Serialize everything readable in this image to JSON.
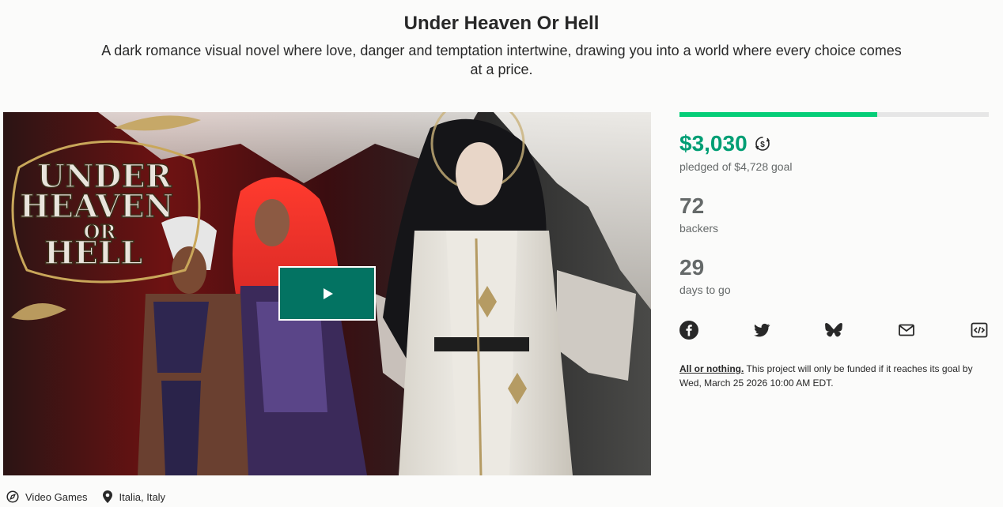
{
  "project": {
    "title": "Under Heaven Or Hell",
    "blurb": "A dark romance visual novel where love, danger and temptation intertwine, drawing you into a world where every choice comes at a price."
  },
  "media": {
    "logo_lines": [
      "UNDER",
      "HEAVEN",
      "OR",
      "HELL"
    ],
    "play_icon": "play-icon"
  },
  "funding": {
    "progress_fraction": 0.64,
    "pledged": "$3,030",
    "pledged_label": "pledged of $4,728 goal",
    "backers": "72",
    "backers_label": "backers",
    "days": "29",
    "days_label": "days to go"
  },
  "share": {
    "icons": [
      "facebook-icon",
      "twitter-icon",
      "bluesky-icon",
      "email-icon",
      "embed-icon"
    ]
  },
  "all_or_nothing": {
    "link": "All or nothing.",
    "text": " This project will only be funded if it reaches its goal by Wed, March 25 2026 10:00 AM EDT."
  },
  "meta": {
    "category": "Video Games",
    "location": "Italia, Italy"
  },
  "colors": {
    "accent_green": "#009e74",
    "progress_green": "#05ce78",
    "play_button": "#037362"
  }
}
